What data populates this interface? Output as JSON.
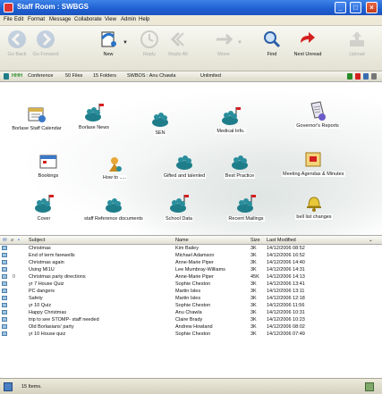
{
  "window": {
    "title": "Staff Room : SWBGS"
  },
  "menu": [
    "File",
    "Edit",
    "Format",
    "Message",
    "Collaborate",
    "View",
    "Admin",
    "Help"
  ],
  "toolbar": {
    "back": "Go Back",
    "next": "Go Forward",
    "new": "New",
    "reply": "Reply",
    "reply_all": "Reply All",
    "move": "Move",
    "find": "Find",
    "next_unread": "Next Unread",
    "upload": "Upload"
  },
  "infobar": {
    "conference": "Conference",
    "files": "50 Files",
    "folders": "15 Folders",
    "user": "SWBOS : Anu Chawla",
    "quota": "Unlimited"
  },
  "icons": [
    "Borlase Staff Calendar",
    "Borlase News",
    "SEN",
    "Medical Info.",
    "Governor's Reports",
    "Bookings",
    "How to .....",
    "Gifted and talented",
    "Best Practice",
    "Meeting Agendas & Minutes",
    "Cover",
    "staff Reference documents",
    "School Data",
    "Recent Mailings",
    "bell list changes"
  ],
  "list": {
    "headers": {
      "subject": "Subject",
      "name": "Name",
      "size": "Size",
      "modified": "Last Modified"
    },
    "rows": [
      {
        "subject": "Christmas",
        "name": "Kim Bailey",
        "size": "3K",
        "date": "14/12/2006 08:52",
        "attach": false
      },
      {
        "subject": "End of term farewells",
        "name": "Michael Adamson",
        "size": "3K",
        "date": "14/12/2006 16:52",
        "attach": false
      },
      {
        "subject": "Christmas again",
        "name": "Anne-Marie Piper",
        "size": "3K",
        "date": "14/12/2006 14:40",
        "attach": false
      },
      {
        "subject": "Using MI1U",
        "name": "Lee Mumbray-Williams",
        "size": "3K",
        "date": "14/12/2006 14:31",
        "attach": false
      },
      {
        "subject": "Christmas party directions",
        "name": "Anne-Marie Piper",
        "size": "45K",
        "date": "14/12/2006 14:13",
        "attach": true
      },
      {
        "subject": "yr 7 House Quiz",
        "name": "Sophie Cheston",
        "size": "3K",
        "date": "14/12/2006 13:41",
        "attach": false
      },
      {
        "subject": "PC dangers",
        "name": "Martin Isles",
        "size": "3K",
        "date": "14/12/2006 13:11",
        "attach": false
      },
      {
        "subject": "Safety",
        "name": "Martin Isles",
        "size": "3K",
        "date": "14/12/2006 12:18",
        "attach": false
      },
      {
        "subject": "yr 10 Quiz",
        "name": "Sophie Cheston",
        "size": "3K",
        "date": "14/12/2006 11:56",
        "attach": false
      },
      {
        "subject": "Happy Christmas",
        "name": "Anu Chawla",
        "size": "3K",
        "date": "14/12/2006 10:31",
        "attach": false
      },
      {
        "subject": "trip to see STOMP- staff needed",
        "name": "Claire Brady",
        "size": "3K",
        "date": "14/12/2006 10:23",
        "attach": false
      },
      {
        "subject": "Old Borlasians' party",
        "name": "Andrew Howland",
        "size": "3K",
        "date": "14/12/2006 08:02",
        "attach": false
      },
      {
        "subject": "yr 10 House quiz",
        "name": "Sophie Cheston",
        "size": "3K",
        "date": "14/12/2006 07:49",
        "attach": false
      }
    ]
  },
  "status": {
    "text": "15 Items."
  },
  "colors": {
    "title_bar": "#1f5fd0",
    "menu_bg": "#ece9d8",
    "folder_teal": "#1f7d8a",
    "flag_red": "#d42020"
  }
}
